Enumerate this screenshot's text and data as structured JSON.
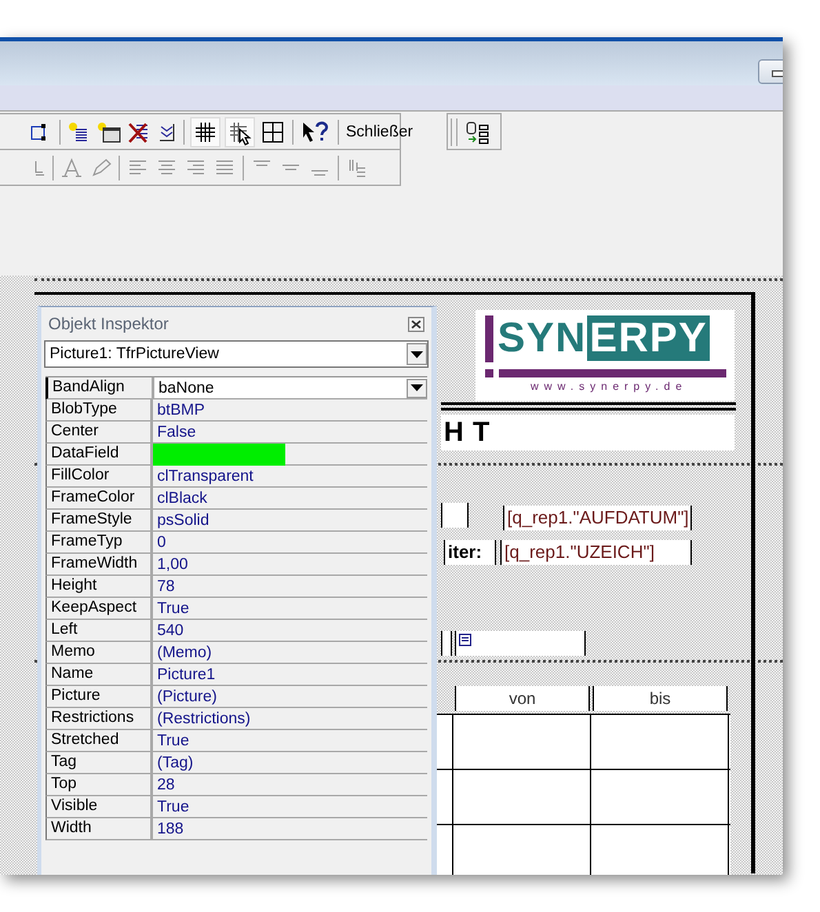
{
  "toolbar": {
    "close_button": "Schließer"
  },
  "inspector": {
    "title": "Objekt Inspektor",
    "object": "Picture1: TfrPictureView",
    "properties": [
      {
        "name": "BandAlign",
        "value": "baNone",
        "selected": true,
        "highlighted": false
      },
      {
        "name": "BlobType",
        "value": "btBMP",
        "selected": false,
        "highlighted": false
      },
      {
        "name": "Center",
        "value": "False",
        "selected": false,
        "highlighted": false
      },
      {
        "name": "DataField",
        "selected": false,
        "highlighted": true
      },
      {
        "name": "FillColor",
        "value": "clTransparent",
        "selected": false,
        "highlighted": false
      },
      {
        "name": "FrameColor",
        "value": "clBlack",
        "selected": false,
        "highlighted": false
      },
      {
        "name": "FrameStyle",
        "value": "psSolid",
        "selected": false,
        "highlighted": false
      },
      {
        "name": "FrameTyp",
        "value": "0",
        "selected": false,
        "highlighted": false
      },
      {
        "name": "FrameWidth",
        "value": "1,00",
        "selected": false,
        "highlighted": false
      },
      {
        "name": "Height",
        "value": "78",
        "selected": false,
        "highlighted": false
      },
      {
        "name": "KeepAspect",
        "value": "True",
        "selected": false,
        "highlighted": false
      },
      {
        "name": "Left",
        "value": "540",
        "selected": false,
        "highlighted": false
      },
      {
        "name": "Memo",
        "value": "(Memo)",
        "selected": false,
        "highlighted": false
      },
      {
        "name": "Name",
        "value": "Picture1",
        "selected": false,
        "highlighted": false
      },
      {
        "name": "Picture",
        "value": "(Picture)",
        "selected": false,
        "highlighted": false
      },
      {
        "name": "Restrictions",
        "value": "(Restrictions)",
        "selected": false,
        "highlighted": false
      },
      {
        "name": "Stretched",
        "value": "True",
        "selected": false,
        "highlighted": false
      },
      {
        "name": "Tag",
        "value": "(Tag)",
        "selected": false,
        "highlighted": false
      },
      {
        "name": "Top",
        "value": "28",
        "selected": false,
        "highlighted": false
      },
      {
        "name": "Visible",
        "value": "True",
        "selected": false,
        "highlighted": false
      },
      {
        "name": "Width",
        "value": "188",
        "selected": false,
        "highlighted": false
      }
    ]
  },
  "report": {
    "logo": {
      "name_start": "SYN",
      "name_boxed": "ERPY",
      "url": "www.synerpy.de"
    },
    "title_fragments": [
      "H",
      "T"
    ],
    "fields": [
      {
        "kind": "field",
        "text": "[q_rep1.\"AUFDATUM\"]"
      },
      {
        "kind": "label",
        "text": "iter:"
      },
      {
        "kind": "field",
        "text": "[q_rep1.\"UZEICH\"]"
      }
    ],
    "table": {
      "columns": [
        "von",
        "bis"
      ]
    }
  }
}
